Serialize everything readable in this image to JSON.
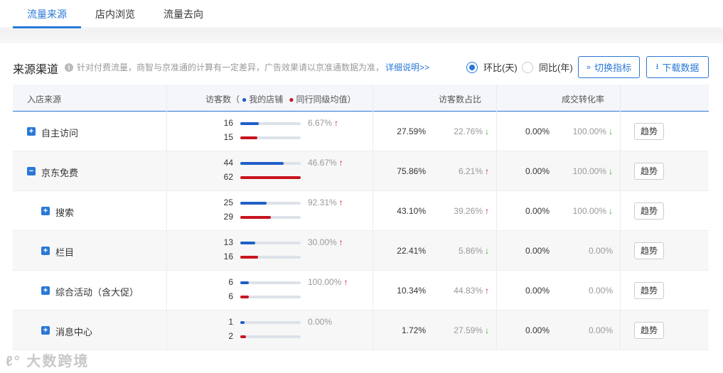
{
  "tabs": [
    {
      "label": "流量来源",
      "active": true
    },
    {
      "label": "店内浏览",
      "active": false
    },
    {
      "label": "流量去向",
      "active": false
    }
  ],
  "section": {
    "title": "来源渠道",
    "note": "针对付费流量，商智与京准通的计算有一定差异，广告效果请以京准通数据为准，",
    "note_link": "详细说明>>"
  },
  "compare": {
    "options": [
      {
        "label": "环比(天)",
        "selected": true
      },
      {
        "label": "同比(年)",
        "selected": false
      }
    ]
  },
  "buttons": {
    "switch_label": "切换指标",
    "download_label": "下载数据"
  },
  "table": {
    "headers": {
      "source": "入店来源",
      "visitors": "访客数（",
      "my_store": "我的店铺",
      "peer_avg": "同行同级均值",
      "close_paren": "）",
      "share": "访客数占比",
      "conversion": "成交转化率"
    },
    "rows": [
      {
        "name": "自主访问",
        "level": 0,
        "expanded": false,
        "mine": 16,
        "peer": 15,
        "mine_frac": 0.3,
        "peer_frac": 0.28,
        "change": "6.67%",
        "change_dir": "up",
        "share": "27.59%",
        "share_change": "22.76%",
        "share_dir": "down",
        "conv": "0.00%",
        "conv_change": "100.00%",
        "conv_dir": "down",
        "trend": "趋势"
      },
      {
        "name": "京东免费",
        "level": 0,
        "expanded": true,
        "mine": 44,
        "peer": 62,
        "mine_frac": 0.72,
        "peer_frac": 1.0,
        "change": "46.67%",
        "change_dir": "up",
        "share": "75.86%",
        "share_change": "6.21%",
        "share_dir": "up",
        "conv": "0.00%",
        "conv_change": "100.00%",
        "conv_dir": "down",
        "trend": "趋势"
      },
      {
        "name": "搜索",
        "level": 1,
        "expanded": false,
        "mine": 25,
        "peer": 29,
        "mine_frac": 0.43,
        "peer_frac": 0.5,
        "change": "92.31%",
        "change_dir": "up",
        "share": "43.10%",
        "share_change": "39.26%",
        "share_dir": "up",
        "conv": "0.00%",
        "conv_change": "100.00%",
        "conv_dir": "down",
        "trend": "趋势"
      },
      {
        "name": "栏目",
        "level": 1,
        "expanded": false,
        "mine": 13,
        "peer": 16,
        "mine_frac": 0.25,
        "peer_frac": 0.29,
        "change": "30.00%",
        "change_dir": "up",
        "share": "22.41%",
        "share_change": "5.86%",
        "share_dir": "down",
        "conv": "0.00%",
        "conv_change": "0.00%",
        "conv_dir": "none",
        "trend": "趋势"
      },
      {
        "name": "综合活动（含大促）",
        "level": 1,
        "expanded": false,
        "mine": 6,
        "peer": 6,
        "mine_frac": 0.14,
        "peer_frac": 0.14,
        "change": "100.00%",
        "change_dir": "up",
        "share": "10.34%",
        "share_change": "44.83%",
        "share_dir": "up",
        "conv": "0.00%",
        "conv_change": "0.00%",
        "conv_dir": "none",
        "trend": "趋势"
      },
      {
        "name": "消息中心",
        "level": 1,
        "expanded": false,
        "mine": 1,
        "peer": 2,
        "mine_frac": 0.07,
        "peer_frac": 0.09,
        "change": "0.00%",
        "change_dir": "none",
        "share": "1.72%",
        "share_change": "27.59%",
        "share_dir": "down",
        "conv": "0.00%",
        "conv_change": "0.00%",
        "conv_dir": "none",
        "trend": "趋势"
      }
    ]
  },
  "colors": {
    "accent": "#2a78d6",
    "my_store": "#1f5fc7",
    "peer": "#c8141e",
    "up": "#d0121b",
    "down": "#3aa33a"
  },
  "watermark": "大数跨境"
}
